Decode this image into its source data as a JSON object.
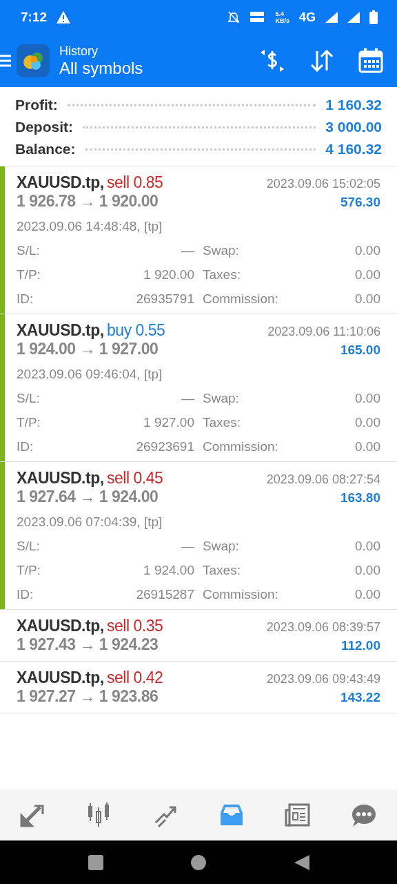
{
  "status_bar": {
    "time": "7:12",
    "speed_value": "5.4",
    "speed_unit": "KB/s",
    "network": "4G"
  },
  "header": {
    "subtitle": "History",
    "title": "All symbols"
  },
  "summary": [
    {
      "label": "Profit:",
      "value": "1 160.32"
    },
    {
      "label": "Deposit:",
      "value": "3 000.00"
    },
    {
      "label": "Balance:",
      "value": "4 160.32"
    }
  ],
  "deals": [
    {
      "symbol": "XAUUSD.tp,",
      "side": "sell",
      "volume": "0.85",
      "open_price": "1 926.78",
      "arrow": "→",
      "close_price": "1 920.00",
      "close_time": "2023.09.06 15:02:05",
      "profit": "576.30",
      "expanded": true,
      "open_time": "2023.09.06 14:48:48, [tp]",
      "details": [
        {
          "label": "S/L:",
          "value": "—",
          "label_2": "Swap:",
          "value_2": "0.00"
        },
        {
          "label": "T/P:",
          "value": "1 920.00",
          "label_2": "Taxes:",
          "value_2": "0.00"
        },
        {
          "label": "ID:",
          "value": "26935791",
          "label_2": "Commission:",
          "value_2": "0.00"
        }
      ]
    },
    {
      "symbol": "XAUUSD.tp,",
      "side": "buy",
      "volume": "0.55",
      "open_price": "1 924.00",
      "arrow": "→",
      "close_price": "1 927.00",
      "close_time": "2023.09.06 11:10:06",
      "profit": "165.00",
      "expanded": true,
      "open_time": "2023.09.06 09:46:04, [tp]",
      "details": [
        {
          "label": "S/L:",
          "value": "—",
          "label_2": "Swap:",
          "value_2": "0.00"
        },
        {
          "label": "T/P:",
          "value": "1 927.00",
          "label_2": "Taxes:",
          "value_2": "0.00"
        },
        {
          "label": "ID:",
          "value": "26923691",
          "label_2": "Commission:",
          "value_2": "0.00"
        }
      ]
    },
    {
      "symbol": "XAUUSD.tp,",
      "side": "sell",
      "volume": "0.45",
      "open_price": "1 927.64",
      "arrow": "→",
      "close_price": "1 924.00",
      "close_time": "2023.09.06 08:27:54",
      "profit": "163.80",
      "expanded": true,
      "open_time": "2023.09.06 07:04:39, [tp]",
      "details": [
        {
          "label": "S/L:",
          "value": "—",
          "label_2": "Swap:",
          "value_2": "0.00"
        },
        {
          "label": "T/P:",
          "value": "1 924.00",
          "label_2": "Taxes:",
          "value_2": "0.00"
        },
        {
          "label": "ID:",
          "value": "26915287",
          "label_2": "Commission:",
          "value_2": "0.00"
        }
      ]
    },
    {
      "symbol": "XAUUSD.tp,",
      "side": "sell",
      "volume": "0.35",
      "open_price": "1 927.43",
      "arrow": "→",
      "close_price": "1 924.23",
      "close_time": "2023.09.06 08:39:57",
      "profit": "112.00",
      "expanded": false
    },
    {
      "symbol": "XAUUSD.tp,",
      "side": "sell",
      "volume": "0.42",
      "open_price": "1 927.27",
      "arrow": "→",
      "close_price": "1 923.86",
      "close_time": "2023.09.06 09:43:49",
      "profit": "143.22",
      "expanded": false
    }
  ],
  "nav": [
    {
      "kind": "trade",
      "selected": false
    },
    {
      "kind": "quotes",
      "selected": false
    },
    {
      "kind": "chart",
      "selected": false
    },
    {
      "kind": "history",
      "selected": true
    },
    {
      "kind": "news",
      "selected": false
    },
    {
      "kind": "chat",
      "selected": false
    }
  ]
}
